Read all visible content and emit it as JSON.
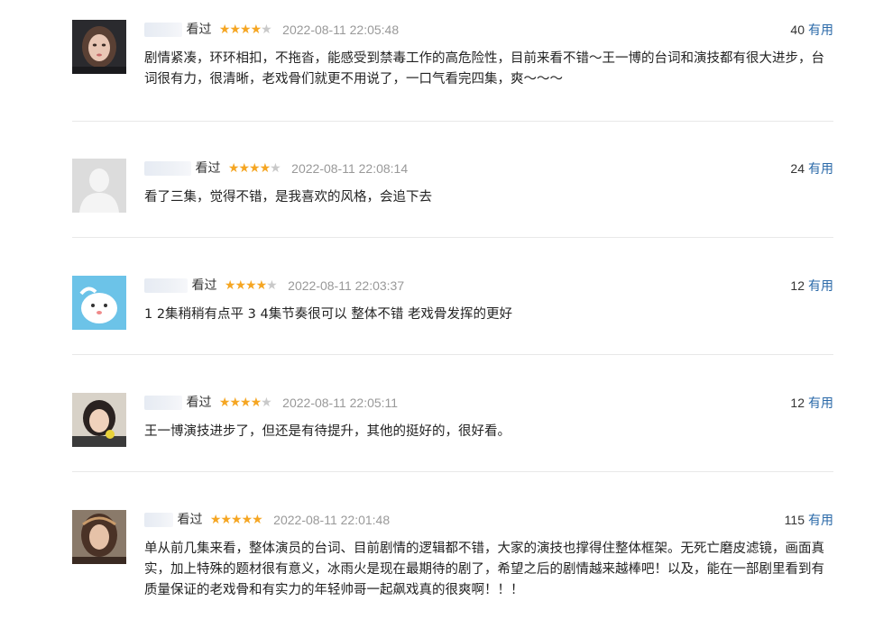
{
  "colors": {
    "star": "#f5a623",
    "star_empty": "#c9c9c9",
    "link": "#2b6aa9",
    "time": "#999999"
  },
  "comments": [
    {
      "watched": "看过",
      "rating": 4,
      "time": "2022-08-11 22:05:48",
      "useful_count": "40",
      "useful_label": "有用",
      "content": "剧情紧凑，环环相扣，不拖沓，能感受到禁毒工作的高危险性，目前来看不错～王一博的台词和演技都有很大进步，台词很有力，很清晰，老戏骨们就更不用说了，一口气看完四集，爽～～～"
    },
    {
      "watched": "看过",
      "rating": 4,
      "time": "2022-08-11 22:08:14",
      "useful_count": "24",
      "useful_label": "有用",
      "content": "看了三集，觉得不错，是我喜欢的风格，会追下去"
    },
    {
      "watched": "看过",
      "rating": 4,
      "time": "2022-08-11 22:03:37",
      "useful_count": "12",
      "useful_label": "有用",
      "content": "1 2集稍稍有点平 3 4集节奏很可以 整体不错 老戏骨发挥的更好"
    },
    {
      "watched": "看过",
      "rating": 4,
      "time": "2022-08-11 22:05:11",
      "useful_count": "12",
      "useful_label": "有用",
      "content": "王一博演技进步了，但还是有待提升，其他的挺好的，很好看。"
    },
    {
      "watched": "看过",
      "rating": 5,
      "time": "2022-08-11 22:01:48",
      "useful_count": "115",
      "useful_label": "有用",
      "content": "单从前几集来看，整体演员的台词、目前剧情的逻辑都不错，大家的演技也撑得住整体框架。无死亡磨皮滤镜，画面真实，加上特殊的题材很有意义，冰雨火是现在最期待的剧了，希望之后的剧情越来越棒吧！以及，能在一部剧里看到有质量保证的老戏骨和有实力的年轻帅哥一起飙戏真的很爽啊！！！"
    }
  ]
}
